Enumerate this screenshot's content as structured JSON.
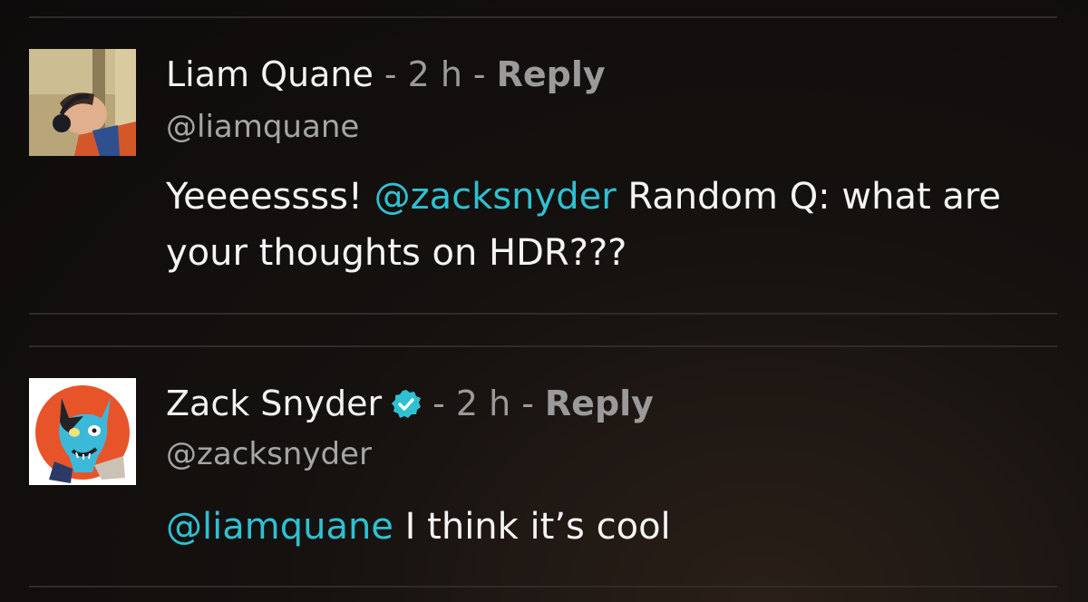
{
  "comments": [
    {
      "author": "Liam Quane",
      "time_sep": "-",
      "time": "2 h",
      "reply_sep": "-",
      "reply_label": "Reply",
      "handle": "@liamquane",
      "text_before": "Yeeeessss!",
      "mention": "@zacksnyder",
      "text_after": "Random Q: what are your thoughts on HDR???",
      "verified": false,
      "avatar_icon": "photo-avatar-headphones"
    },
    {
      "author": "Zack Snyder",
      "time_sep": "-",
      "time": "2 h",
      "reply_sep": "-",
      "reply_label": "Reply",
      "handle": "@zacksnyder",
      "text_before": "",
      "mention": "@liamquane",
      "text_after": "I think it’s cool",
      "verified": true,
      "verified_icon": "verified-badge-icon",
      "avatar_icon": "illustrated-zombie-batman-avatar"
    }
  ],
  "colors": {
    "mention": "#2fc0d2",
    "meta": "#9a9a9a",
    "verified": "#2fc0d2",
    "background": "#110e0d"
  }
}
